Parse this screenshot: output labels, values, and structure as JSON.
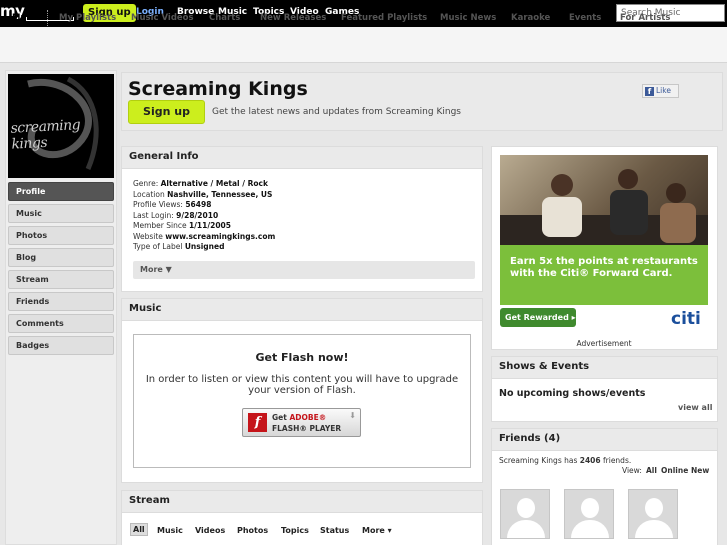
{
  "topbar": {
    "logo": "my",
    "signup": "Sign up",
    "login": "Login",
    "nav": [
      "Browse",
      "Music",
      "Topics",
      "Video",
      "Games"
    ],
    "search_placeholder": "Search Music"
  },
  "subnav": [
    "Music",
    "My Playlists",
    "Music Videos",
    "Charts",
    "New Releases",
    "Featured Playlists",
    "Music News",
    "Karaoke",
    "Events",
    "For Artists"
  ],
  "sidebar": {
    "photo_caption": "screaming kings",
    "items": [
      "Profile",
      "Music",
      "Photos",
      "Blog",
      "Stream",
      "Friends",
      "Comments",
      "Badges"
    ]
  },
  "header": {
    "title": "Screaming Kings",
    "like": "Like",
    "signup": "Sign up",
    "tagline": "Get the latest news and updates from Screaming Kings"
  },
  "general_info": {
    "title": "General Info",
    "rows": [
      {
        "label": "Genre: ",
        "value": "Alternative / Metal / Rock"
      },
      {
        "label": "Location ",
        "value": "Nashville, Tennessee, US"
      },
      {
        "label": "Profile Views: ",
        "value": "56498"
      },
      {
        "label": "Last Login: ",
        "value": "9/28/2010"
      },
      {
        "label": "Member Since ",
        "value": "1/11/2005"
      },
      {
        "label": "Website ",
        "value": "www.screamingkings.com"
      },
      {
        "label": "Type of Label ",
        "value": "Unsigned"
      }
    ],
    "more": "More ▼"
  },
  "music": {
    "title": "Music",
    "flash_title": "Get Flash now!",
    "flash_message": "In order to listen or view this content you will have to upgrade your version of Flash.",
    "flash_button_line1_prefix": "Get ",
    "flash_button_line1_brand": "ADOBE®",
    "flash_button_line2": "FLASH® PLAYER"
  },
  "stream": {
    "title": "Stream",
    "tabs": [
      "All",
      "Music",
      "Videos",
      "Photos",
      "Topics",
      "Status",
      "More ▾"
    ]
  },
  "ad": {
    "headline": "Earn 5x the points at restaurants with the Citi® Forward Card.",
    "button": "Get Rewarded ▸",
    "brand": "citi",
    "label": "Advertisement"
  },
  "shows": {
    "title": "Shows & Events",
    "empty": "No upcoming shows/events",
    "view_all": "view all"
  },
  "friends": {
    "title": "Friends (4)",
    "summary_prefix": "Screaming Kings has ",
    "summary_count": "2406",
    "summary_suffix": " friends.",
    "view_label": "View:",
    "view_options": [
      "All",
      "Online",
      "New"
    ]
  },
  "colors": {
    "signup": "#ccee1d",
    "topbar": "#000000",
    "ad_green": "#7cbf3b",
    "citi_blue": "#1b4f9c"
  }
}
